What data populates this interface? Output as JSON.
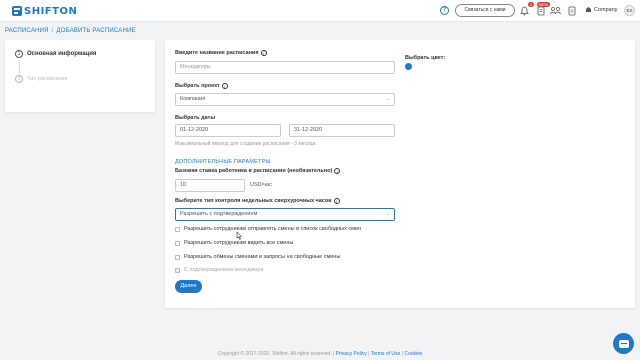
{
  "app": {
    "logo_text": "SHIFTON"
  },
  "topbar": {
    "help_icon": "question-circle-icon",
    "contact_label": "Связаться с нами",
    "notifications_badge": "1",
    "news_badge": "NEW",
    "company_label": "Company",
    "avatar_initials": "ES"
  },
  "breadcrumb": {
    "parent": "РАСПИСАНИЯ",
    "separator": "/",
    "current": "ДОБАВИТЬ РАСПИСАНИЕ"
  },
  "steps": [
    {
      "num": "1",
      "label": "Основная информация",
      "active": true
    },
    {
      "num": "2",
      "label": "Тип расписания",
      "active": false
    }
  ],
  "form": {
    "name_label": "Введите название расписания",
    "name_placeholder": "Менеджеры",
    "color_label": "Выбрать цвет:",
    "color_value": "#1e78c8",
    "project_label": "Выбрать проект",
    "project_value": "Компания",
    "dates_label": "Выбрать даты",
    "date_start": "01-12-2020",
    "date_end": "31-12-2020",
    "dates_hint": "Максимальный период для создания расписания - 3 месяца",
    "additional_section": "ДОПОЛНИТЕЛЬНЫЕ ПАРАМЕТРЫ",
    "rate_label": "Базовая ставка работника в расписании (необязательно)",
    "rate_value": "10",
    "rate_unit": "USD/час",
    "overtime_label": "Выберите тип контроля недельных сверхурочных часов",
    "overtime_value": "Разрешить с подтверждением",
    "checkboxes": [
      {
        "label": "Разрешить сотрудникам отправлять смены в список свободных смен",
        "disabled": false
      },
      {
        "label": "Разрешить сотрудникам видеть все смены",
        "disabled": false
      },
      {
        "label": "Разрешить обмены сменами и запросы на свободные смены",
        "disabled": false
      },
      {
        "label": "С подтверждением менеджера",
        "disabled": true
      }
    ],
    "next_label": "Далее"
  },
  "footer": {
    "copyright": "Copyright © 2017-2020. Shifton. All rights reserved. |",
    "privacy": "Privacy Policy",
    "sep1": "|",
    "terms": "Terms of Use",
    "sep2": "|",
    "cookies": "Cookies"
  }
}
